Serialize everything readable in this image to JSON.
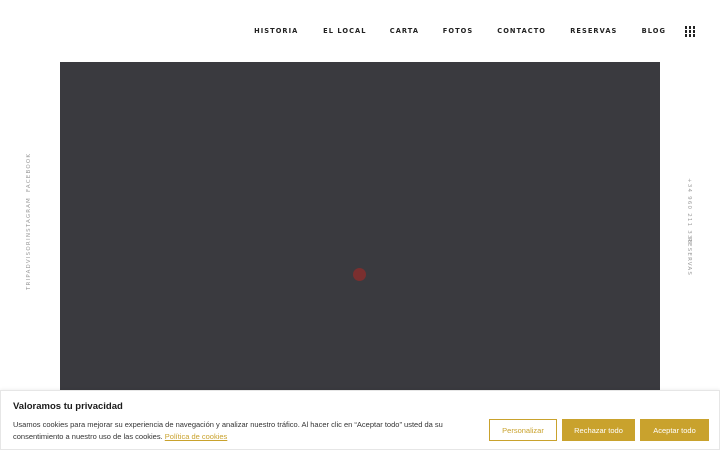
{
  "nav": {
    "items": [
      "HISTORIA",
      "EL LOCAL",
      "CARTA",
      "FOTOS",
      "CONTACTO",
      "RESERVAS",
      "BLOG"
    ],
    "menu_icon": "grid-menu-icon"
  },
  "social": {
    "tripadvisor": "TRIPADVISOR",
    "instagram": "INSTAGRAM",
    "facebook": "FACEBOOK"
  },
  "contact": {
    "reservas_label": "RESERVAS",
    "phone": "+34 960 211 338"
  },
  "cookie": {
    "title": "Valoramos tu privacidad",
    "text": "Usamos cookies para mejorar su experiencia de navegación y analizar nuestro tráfico. Al hacer clic en “Aceptar todo” usted da su consentimiento a nuestro uso de las cookies.",
    "link": "Política de cookies",
    "customize": "Personalizar",
    "reject": "Rechazar todo",
    "accept": "Aceptar todo"
  },
  "colors": {
    "accent": "#c9a22d",
    "hero_bg": "#3a3a3f",
    "loader": "#7a2f2f"
  }
}
